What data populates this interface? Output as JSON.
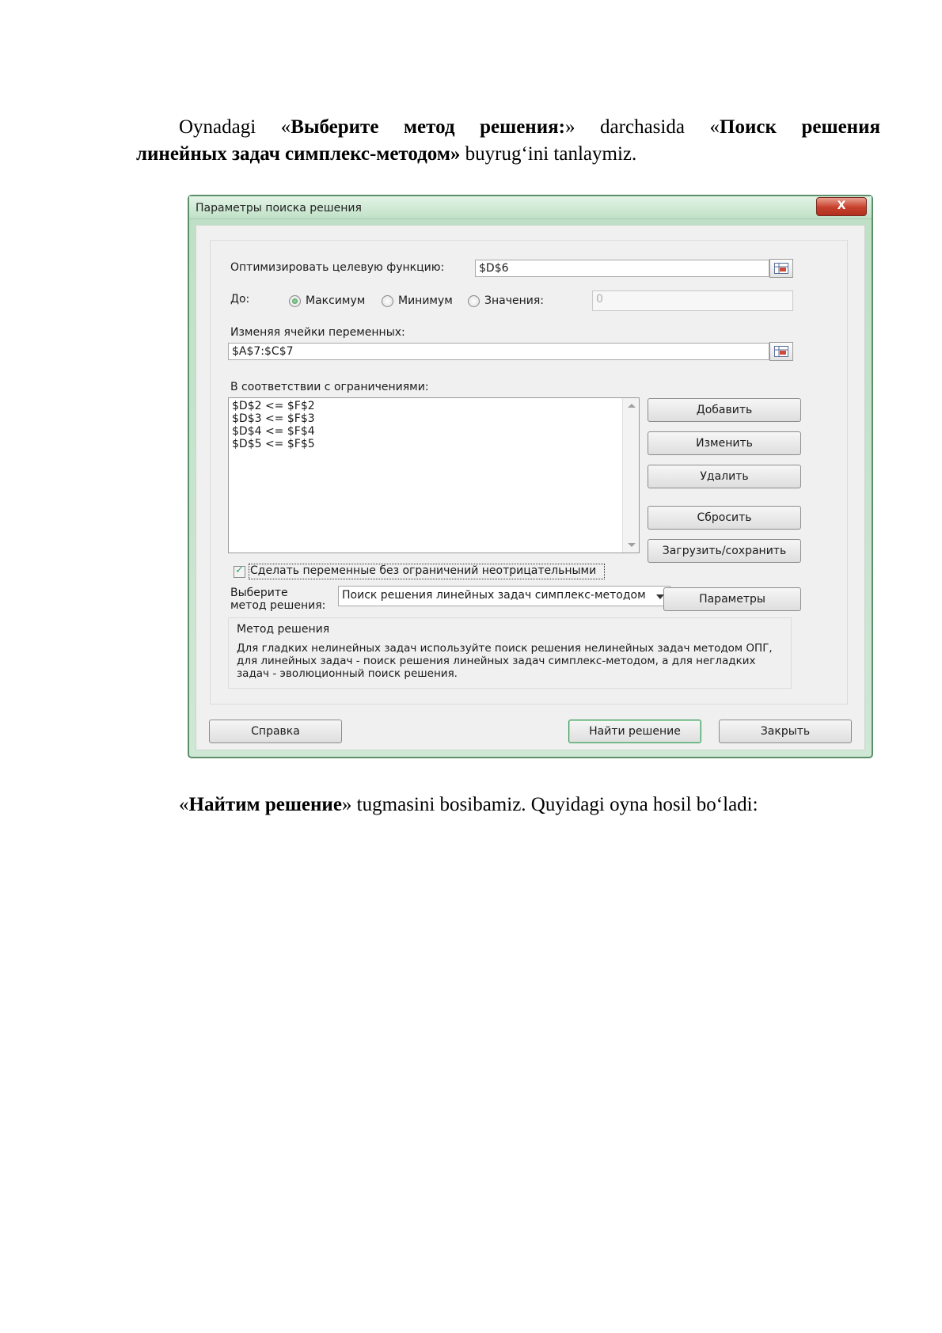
{
  "doc": {
    "p1_indent_text": "Oynadagi «",
    "p1_bold1": "Выберите метод решения:",
    "p1_mid": "» darchasida «",
    "p1_bold2a": "Поиск решения",
    "p1_bold2b": "линейных задач симплекс-методом»",
    "p1_tail": "  buyrug‘ini tanlaymiz.",
    "p2_open": "«",
    "p2_bold": "Найтим решение",
    "p2_tail": "» tugmasini bosibamiz. Quyidagi oyna hosil bo‘ladi:"
  },
  "dialog": {
    "title": "Параметры поиска решения",
    "close_label": "X",
    "objective_label": "Оптимизировать целевую функцию:",
    "objective_value": "$D$6",
    "to_label": "До:",
    "radio_max": "Максимум",
    "radio_min": "Минимум",
    "radio_value": "Значения:",
    "value_field": "0",
    "changing_label": "Изменяя ячейки переменных:",
    "changing_value": "$A$7:$C$7",
    "constraints_label": "В соответствии с ограничениями:",
    "constraints": [
      "$D$2 <= $F$2",
      "$D$3 <= $F$3",
      "$D$4 <= $F$4",
      "$D$5 <= $F$5"
    ],
    "btn_add": "Добавить",
    "btn_change": "Изменить",
    "btn_delete": "Удалить",
    "btn_reset": "Сбросить",
    "btn_load_save": "Загрузить/сохранить",
    "nonneg_label": "Сделать переменные без ограничений неотрицательными",
    "method_label_1": "Выберите",
    "method_label_2": "метод решения:",
    "method_value": "Поиск решения линейных задач симплекс-методом",
    "btn_params": "Параметры",
    "group_title": "Метод решения",
    "desc_1": "Для гладких нелинейных задач используйте поиск решения нелинейных задач методом ОПГ,",
    "desc_2": "для линейных задач - поиск решения линейных задач симплекс-методом, а для негладких",
    "desc_3": "задач - эволюционный поиск решения.",
    "btn_help": "Справка",
    "btn_solve": "Найти решение",
    "btn_close": "Закрыть"
  }
}
